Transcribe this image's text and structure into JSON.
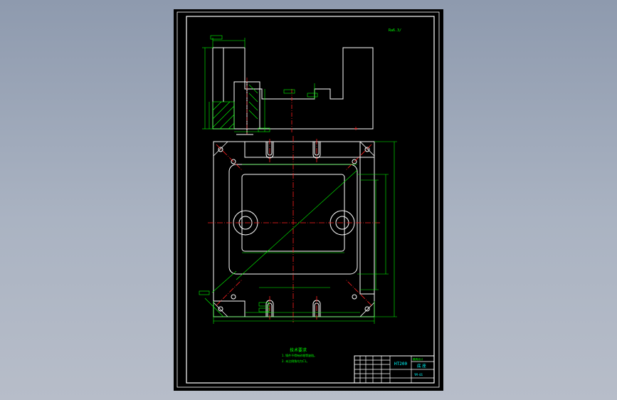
{
  "app": {
    "background_color": "#a3adbd",
    "sheet_color": "#000000",
    "line_color": "#ffffff",
    "dim_color": "#00ff00",
    "center_color": "#ff2020",
    "title_color": "#00ffff"
  },
  "drawing": {
    "roughness_label": "Ra6.3/",
    "tech_title": "技术要求",
    "notes": [
      "1. 铸件不得有砂眼等缺陷。",
      "2. 未注倒角均为C1。"
    ],
    "material": "HT200",
    "part_name": "底 座",
    "drawing_no": "YM-01",
    "company": "模具设计"
  }
}
